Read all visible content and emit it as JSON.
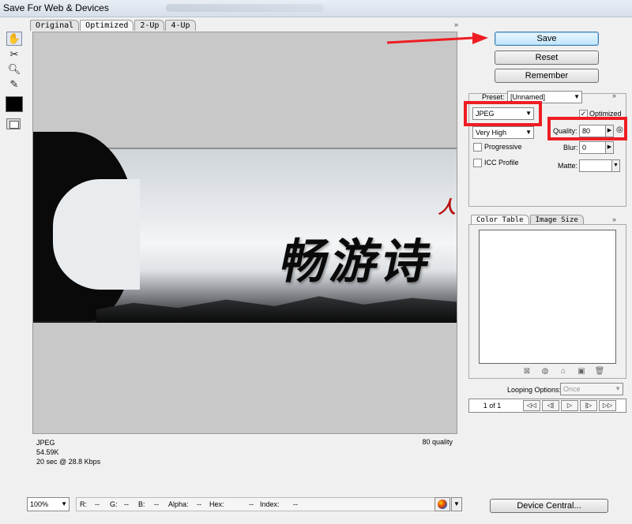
{
  "window": {
    "title": "Save For Web & Devices"
  },
  "tabs": [
    "Original",
    "Optimized",
    "2-Up",
    "4-Up"
  ],
  "canvas": {
    "image_text": "畅游诗",
    "image_red_mark": "人"
  },
  "image_info": {
    "format": "JPEG",
    "size": "54.59K",
    "time": "20 sec @ 28.8 Kbps",
    "quality": "80 quality"
  },
  "status": {
    "zoom": "100%",
    "r": "R:",
    "r_val": "--",
    "g": "G:",
    "g_val": "--",
    "b": "B:",
    "b_val": "--",
    "alpha": "Alpha:",
    "alpha_val": "--",
    "hex": "Hex:",
    "hex_val": "--",
    "index": "Index:",
    "index_val": "--"
  },
  "actions": {
    "save": "Save",
    "reset": "Reset",
    "remember": "Remember",
    "device_central": "Device Central..."
  },
  "settings": {
    "preset_label": "Preset:",
    "preset_value": "[Unnamed]",
    "format": "JPEG",
    "quality_preset": "Very High",
    "optimized_label": "Optimized",
    "optimized_checked": true,
    "quality_label": "Quality:",
    "quality_value": "80",
    "progressive_label": "Progressive",
    "progressive_checked": false,
    "blur_label": "Blur:",
    "blur_value": "0",
    "icc_label": "ICC Profile",
    "icc_checked": false,
    "matte_label": "Matte:",
    "matte_value": ""
  },
  "panel_tabs": [
    "Color Table",
    "Image Size"
  ],
  "animation": {
    "looping_label": "Looping Options:",
    "looping_value": "Once",
    "frame_count": "1 of 1"
  },
  "colors": {
    "highlight": "#ee1d23",
    "save_button": "#bee6fd"
  }
}
